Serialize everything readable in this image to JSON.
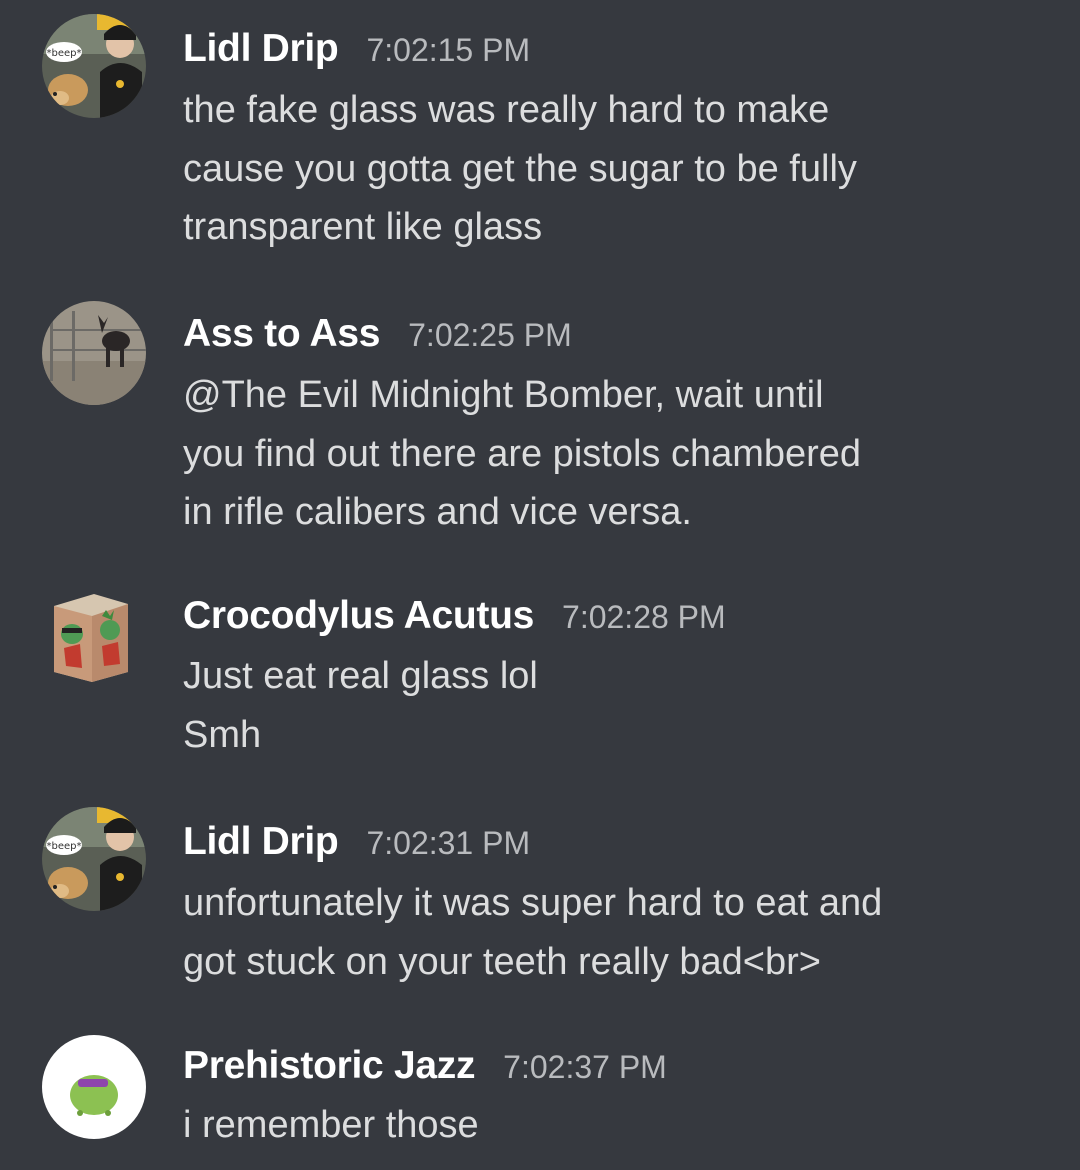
{
  "messages": [
    {
      "author": "Lidl Drip",
      "time": "7:02:15 PM",
      "avatar_icon": "person-with-dog-avatar",
      "lines": [
        "the fake glass was really hard to make",
        "cause you gotta get the sugar to be fully",
        "transparent like glass"
      ],
      "avatar_badge": "*beep*"
    },
    {
      "author": "Ass to Ass",
      "time": "7:02:25 PM",
      "avatar_icon": "donkey-photo-avatar",
      "lines": [
        "@The Evil Midnight Bomber, wait until",
        "you find out there are pistols chambered",
        "in rifle calibers and vice versa."
      ]
    },
    {
      "author": "Crocodylus Acutus",
      "time": "7:02:28 PM",
      "avatar_icon": "cube-character-avatar",
      "lines": [
        "Just eat real glass lol",
        "Smh"
      ]
    },
    {
      "author": "Lidl Drip",
      "time": "7:02:31 PM",
      "avatar_icon": "person-with-dog-avatar",
      "lines": [
        "unfortunately it was super hard to eat and",
        "got stuck on your teeth really bad<br>"
      ],
      "avatar_badge": "*beep*"
    },
    {
      "author": "Prehistoric Jazz",
      "time": "7:02:37 PM",
      "avatar_icon": "green-blob-avatar",
      "lines": [
        "i remember those"
      ]
    }
  ],
  "colors": {
    "background": "#36393f",
    "author": "#ffffff",
    "timestamp": "#b9bbbe",
    "message_text": "#dcddde"
  }
}
